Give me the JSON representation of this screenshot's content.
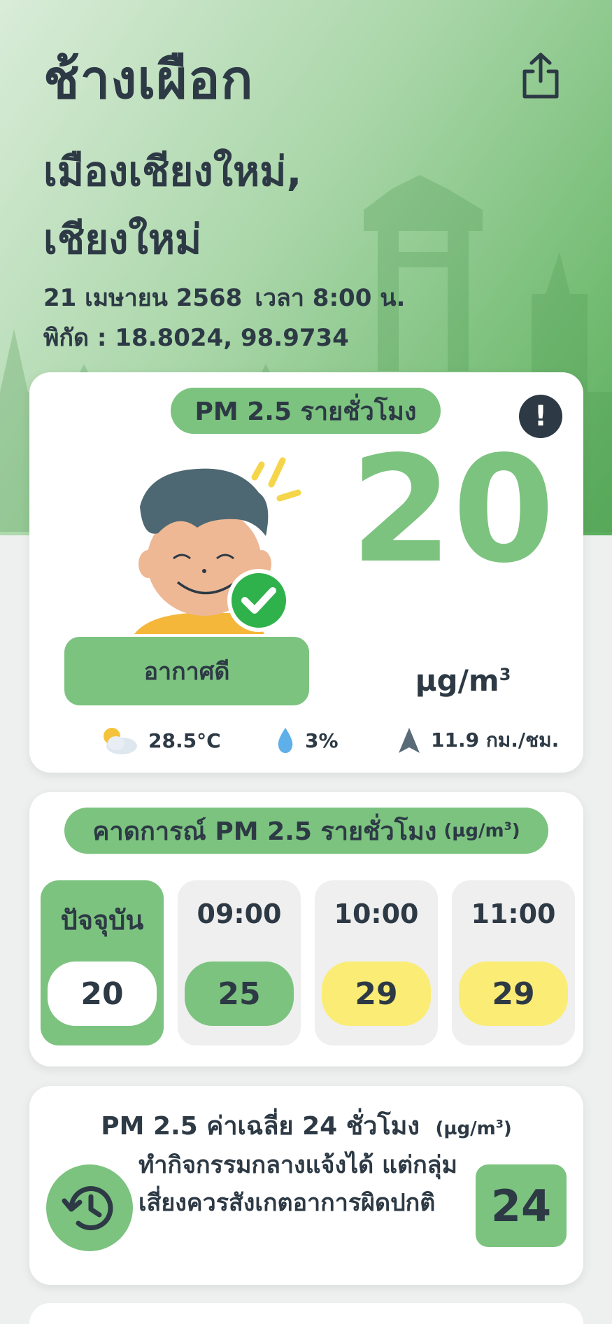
{
  "header": {
    "title": "ช้างเผือก",
    "district": "เมืองเชียงใหม่,",
    "province": "เชียงใหม่",
    "date": "21 เมษายน 2568",
    "time": "เวลา 8:00 น.",
    "coords": "พิกัด : 18.8024, 98.9734",
    "share_icon": "share-icon"
  },
  "current": {
    "label": "PM 2.5 รายชั่วโมง",
    "info_icon": "exclamation-icon",
    "value": "20",
    "unit_base": "µg/m",
    "unit_exp": "3",
    "status": "อากาศดี",
    "temperature": "28.5°C",
    "humidity": "3%",
    "wind": "11.9 กม./ชม.",
    "colors": {
      "good": "#7cc37f",
      "moderate": "#fbec75"
    }
  },
  "forecast": {
    "label": "คาดการณ์ PM 2.5 รายชั่วโมง",
    "unit_base": "(µg/m",
    "unit_exp": "3",
    "unit_close": ")",
    "items": [
      {
        "time": "ปัจจุบัน",
        "value": "20"
      },
      {
        "time": "09:00",
        "value": "25"
      },
      {
        "time": "10:00",
        "value": "29"
      },
      {
        "time": "11:00",
        "value": "29"
      }
    ]
  },
  "average": {
    "label": "PM 2.5 ค่าเฉลี่ย 24 ชั่วโมง",
    "unit_base": "(µg/m",
    "unit_exp": "3",
    "unit_close": ")",
    "advice": "ทำกิจกรรมกลางแจ้งได้ แต่กลุ่มเสี่ยงควรสังเกตอาการผิดปกติ",
    "value": "24",
    "icon": "history-icon"
  }
}
